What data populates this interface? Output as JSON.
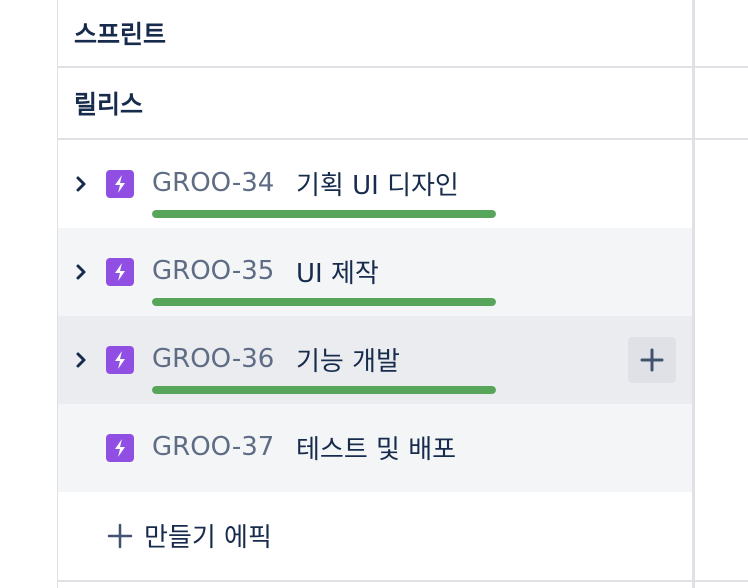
{
  "sections": {
    "sprint_label": "스프린트",
    "release_label": "릴리스"
  },
  "epics": [
    {
      "key": "GROO-34",
      "title": "기획 UI 디자인",
      "expandable": true,
      "progress_fraction": 1.0
    },
    {
      "key": "GROO-35",
      "title": "UI 제작",
      "expandable": true,
      "progress_fraction": 1.0
    },
    {
      "key": "GROO-36",
      "title": "기능 개발",
      "expandable": true,
      "progress_fraction": 1.0
    },
    {
      "key": "GROO-37",
      "title": "테스트 및 배포",
      "expandable": false
    }
  ],
  "create_epic": {
    "label": "만들기 에픽"
  },
  "colors": {
    "epic_icon": "#904ee2",
    "progress_done": "#57a55a",
    "key_text": "#5e6c84",
    "title_text": "#172b4d"
  },
  "icons": {
    "expand": "chevron-right-icon",
    "epic": "lightning-icon",
    "add": "plus-icon"
  }
}
